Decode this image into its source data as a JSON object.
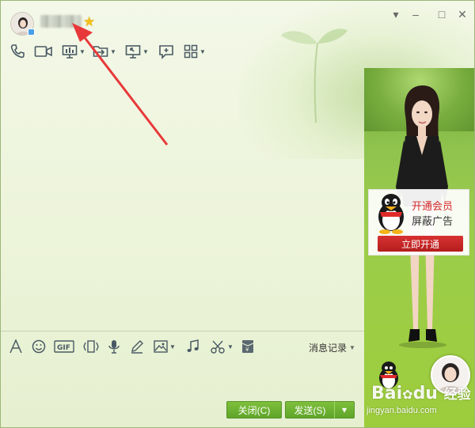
{
  "window": {
    "contact_name": "",
    "vip_icon": "star-icon",
    "controls": {
      "minimize": "–",
      "maximize": "□",
      "close": "✕",
      "dropdown": "▾"
    }
  },
  "toolbar": {
    "icons": [
      "phone-icon",
      "video-icon",
      "screen-share-icon",
      "file-transfer-icon",
      "remote-desktop-icon",
      "new-discussion-icon",
      "apps-icon"
    ]
  },
  "input_toolbar": {
    "icons": [
      "font-icon",
      "emoji-icon",
      "gif-icon",
      "shake-icon",
      "voice-icon",
      "handwriting-icon",
      "image-icon",
      "music-icon",
      "screenshot-icon",
      "red-packet-icon"
    ],
    "gif_label": "GIF",
    "history_label": "消息记录"
  },
  "buttons": {
    "close": "关闭(C)",
    "send": "发送(S)",
    "send_menu": "▾"
  },
  "ad": {
    "line1": "开通会员",
    "line2": "屏蔽广告",
    "cta": "立即开通"
  },
  "watermark": {
    "brand": "Bai",
    "brand2": "du",
    "brand_cn": "经验",
    "url": "jingyan.baidu.com"
  },
  "colors": {
    "accent_green": "#5fa52a",
    "ad_red": "#c52424",
    "annotation_arrow": "#e8393a"
  }
}
